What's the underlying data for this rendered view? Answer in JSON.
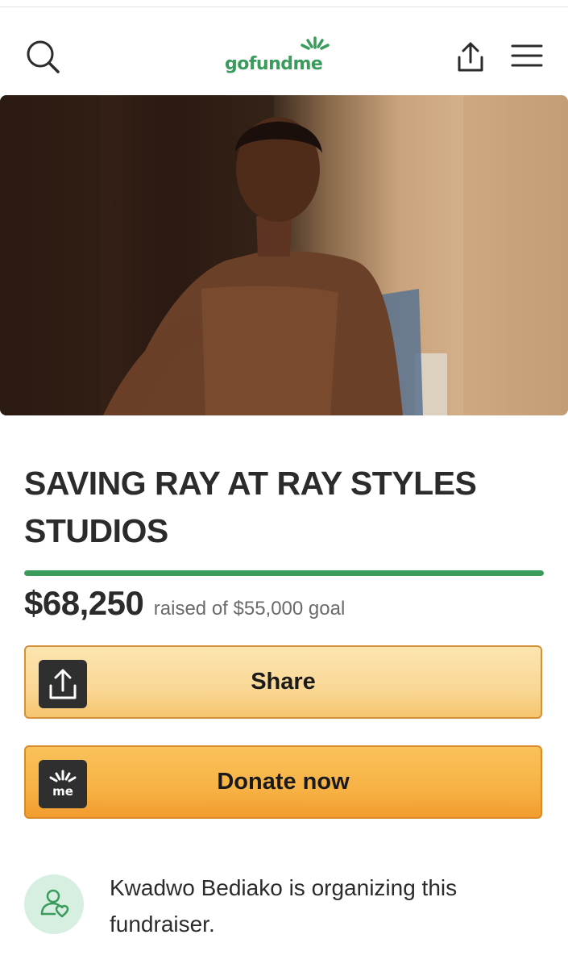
{
  "header": {
    "logo_text": "gofundme",
    "icons": [
      "search-icon",
      "share-icon",
      "menu-icon"
    ]
  },
  "hero_image": {
    "subject": "photo"
  },
  "campaign": {
    "title": "SAVING RAY AT RAY STYLES STUDIOS",
    "raised": "$68,250",
    "raised_suffix": "raised of $55,000 goal",
    "progress_fraction": 1.0
  },
  "buttons": {
    "share_label": "Share",
    "donate_label": "Donate now",
    "donate_icon_text": "me"
  },
  "organizer": {
    "text": "Kwadwo Bediako is organizing this fundraiser."
  },
  "colors": {
    "brand_green": "#3a9b5c",
    "share_button": "#f9d795",
    "donate_button": "#f7b245",
    "avatar_bg": "#d6efe0"
  }
}
